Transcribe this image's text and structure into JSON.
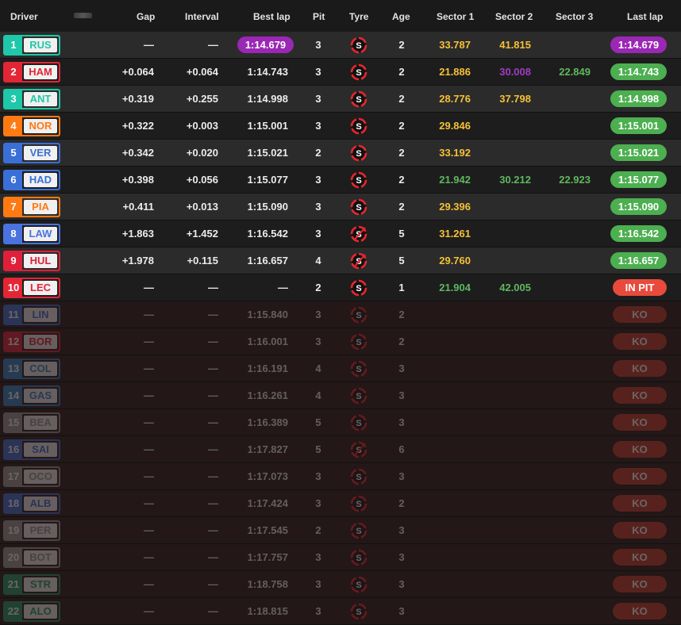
{
  "colors": {
    "purple": "#9b27b5",
    "green": "#4caf50",
    "yellow": "#f5c137",
    "sector_purple": "#a03cc4",
    "sector_green": "#5fb85f",
    "ko_red": "#c0392b",
    "in_pit_red": "#e84a3c",
    "soft_tyre": "#e8262e"
  },
  "headers": {
    "driver": "Driver",
    "gap": "Gap",
    "interval": "Interval",
    "best_lap": "Best lap",
    "pit": "Pit",
    "tyre": "Tyre",
    "age": "Age",
    "sector1": "Sector 1",
    "sector2": "Sector 2",
    "sector3": "Sector 3",
    "last_lap": "Last lap"
  },
  "rows": [
    {
      "pos": "1",
      "code": "RUS",
      "team_color": "#1ec8a8",
      "gap": "—",
      "interval": "—",
      "best": "1:14.679",
      "best_style": "purple",
      "pit": "3",
      "tyre": "soft-tyre-icon",
      "age": "2",
      "s1": "33.787",
      "s1c": "yellow",
      "s2": "41.815",
      "s2c": "yellow",
      "s3": "",
      "s3c": "",
      "last": "1:14.679",
      "last_style": "purple",
      "ko": false
    },
    {
      "pos": "2",
      "code": "HAM",
      "team_color": "#e32636",
      "gap": "+0.064",
      "interval": "+0.064",
      "best": "1:14.743",
      "best_style": "",
      "pit": "3",
      "tyre": "soft-tyre-icon",
      "age": "2",
      "s1": "21.886",
      "s1c": "yellow",
      "s2": "30.008",
      "s2c": "purple",
      "s3": "22.849",
      "s3c": "green",
      "last": "1:14.743",
      "last_style": "green",
      "ko": false
    },
    {
      "pos": "3",
      "code": "ANT",
      "team_color": "#1ec8a8",
      "gap": "+0.319",
      "interval": "+0.255",
      "best": "1:14.998",
      "best_style": "",
      "pit": "3",
      "tyre": "soft-tyre-icon",
      "age": "2",
      "s1": "28.776",
      "s1c": "yellow",
      "s2": "37.798",
      "s2c": "yellow",
      "s3": "",
      "s3c": "",
      "last": "1:14.998",
      "last_style": "green",
      "ko": false
    },
    {
      "pos": "4",
      "code": "NOR",
      "team_color": "#ff7a12",
      "gap": "+0.322",
      "interval": "+0.003",
      "best": "1:15.001",
      "best_style": "",
      "pit": "3",
      "tyre": "soft-tyre-icon",
      "age": "2",
      "s1": "29.846",
      "s1c": "yellow",
      "s2": "",
      "s2c": "",
      "s3": "",
      "s3c": "",
      "last": "1:15.001",
      "last_style": "green",
      "ko": false
    },
    {
      "pos": "5",
      "code": "VER",
      "team_color": "#3a6fd8",
      "gap": "+0.342",
      "interval": "+0.020",
      "best": "1:15.021",
      "best_style": "",
      "pit": "2",
      "tyre": "soft-tyre-icon",
      "age": "2",
      "s1": "33.192",
      "s1c": "yellow",
      "s2": "",
      "s2c": "",
      "s3": "",
      "s3c": "",
      "last": "1:15.021",
      "last_style": "green",
      "ko": false
    },
    {
      "pos": "6",
      "code": "HAD",
      "team_color": "#3a6fd8",
      "gap": "+0.398",
      "interval": "+0.056",
      "best": "1:15.077",
      "best_style": "",
      "pit": "3",
      "tyre": "soft-tyre-icon",
      "age": "2",
      "s1": "21.942",
      "s1c": "green",
      "s2": "30.212",
      "s2c": "green",
      "s3": "22.923",
      "s3c": "green",
      "last": "1:15.077",
      "last_style": "green",
      "ko": false
    },
    {
      "pos": "7",
      "code": "PIA",
      "team_color": "#ff7a12",
      "gap": "+0.411",
      "interval": "+0.013",
      "best": "1:15.090",
      "best_style": "",
      "pit": "3",
      "tyre": "soft-tyre-icon",
      "age": "2",
      "s1": "29.396",
      "s1c": "yellow",
      "s2": "",
      "s2c": "",
      "s3": "",
      "s3c": "",
      "last": "1:15.090",
      "last_style": "green",
      "ko": false
    },
    {
      "pos": "8",
      "code": "LAW",
      "team_color": "#4a72e0",
      "gap": "+1.863",
      "interval": "+1.452",
      "best": "1:16.542",
      "best_style": "",
      "pit": "3",
      "tyre": "soft-tyre-used-icon",
      "age": "5",
      "s1": "31.261",
      "s1c": "yellow",
      "s2": "",
      "s2c": "",
      "s3": "",
      "s3c": "",
      "last": "1:16.542",
      "last_style": "green",
      "ko": false
    },
    {
      "pos": "9",
      "code": "HUL",
      "team_color": "#e0203a",
      "gap": "+1.978",
      "interval": "+0.115",
      "best": "1:16.657",
      "best_style": "",
      "pit": "4",
      "tyre": "soft-tyre-used-icon",
      "age": "5",
      "s1": "29.760",
      "s1c": "yellow",
      "s2": "",
      "s2c": "",
      "s3": "",
      "s3c": "",
      "last": "1:16.657",
      "last_style": "green",
      "ko": false
    },
    {
      "pos": "10",
      "code": "LEC",
      "team_color": "#e32636",
      "gap": "—",
      "interval": "—",
      "best": "—",
      "best_style": "",
      "pit": "2",
      "tyre": "soft-tyre-icon",
      "age": "1",
      "s1": "21.904",
      "s1c": "green",
      "s2": "42.005",
      "s2c": "green",
      "s3": "",
      "s3c": "",
      "last": "IN PIT",
      "last_style": "inpit",
      "ko": false
    },
    {
      "pos": "11",
      "code": "LIN",
      "team_color": "#3a6fd8",
      "gap": "—",
      "interval": "—",
      "best": "1:15.840",
      "best_style": "",
      "pit": "3",
      "tyre": "soft-tyre-icon",
      "age": "2",
      "s1": "",
      "s1c": "",
      "s2": "",
      "s2c": "",
      "s3": "",
      "s3c": "",
      "last": "KO",
      "last_style": "ko",
      "ko": true
    },
    {
      "pos": "12",
      "code": "BOR",
      "team_color": "#e0203a",
      "gap": "—",
      "interval": "—",
      "best": "1:16.001",
      "best_style": "",
      "pit": "3",
      "tyre": "soft-tyre-icon",
      "age": "2",
      "s1": "",
      "s1c": "",
      "s2": "",
      "s2c": "",
      "s3": "",
      "s3c": "",
      "last": "KO",
      "last_style": "ko",
      "ko": true
    },
    {
      "pos": "13",
      "code": "COL",
      "team_color": "#2f86c8",
      "gap": "—",
      "interval": "—",
      "best": "1:16.191",
      "best_style": "",
      "pit": "4",
      "tyre": "soft-tyre-icon",
      "age": "3",
      "s1": "",
      "s1c": "",
      "s2": "",
      "s2c": "",
      "s3": "",
      "s3c": "",
      "last": "KO",
      "last_style": "ko",
      "ko": true
    },
    {
      "pos": "14",
      "code": "GAS",
      "team_color": "#2f86c8",
      "gap": "—",
      "interval": "—",
      "best": "1:16.261",
      "best_style": "",
      "pit": "4",
      "tyre": "soft-tyre-icon",
      "age": "3",
      "s1": "",
      "s1c": "",
      "s2": "",
      "s2c": "",
      "s3": "",
      "s3c": "",
      "last": "KO",
      "last_style": "ko",
      "ko": true
    },
    {
      "pos": "15",
      "code": "BEA",
      "team_color": "#9a9a9a",
      "gap": "—",
      "interval": "—",
      "best": "1:16.389",
      "best_style": "",
      "pit": "5",
      "tyre": "soft-tyre-icon",
      "age": "3",
      "s1": "",
      "s1c": "",
      "s2": "",
      "s2c": "",
      "s3": "",
      "s3c": "",
      "last": "KO",
      "last_style": "ko",
      "ko": true
    },
    {
      "pos": "16",
      "code": "SAI",
      "team_color": "#3a6fd8",
      "gap": "—",
      "interval": "—",
      "best": "1:17.827",
      "best_style": "",
      "pit": "5",
      "tyre": "soft-tyre-used-icon",
      "age": "6",
      "s1": "",
      "s1c": "",
      "s2": "",
      "s2c": "",
      "s3": "",
      "s3c": "",
      "last": "KO",
      "last_style": "ko",
      "ko": true
    },
    {
      "pos": "17",
      "code": "OCO",
      "team_color": "#9a9a9a",
      "gap": "—",
      "interval": "—",
      "best": "1:17.073",
      "best_style": "",
      "pit": "3",
      "tyre": "soft-tyre-icon",
      "age": "3",
      "s1": "",
      "s1c": "",
      "s2": "",
      "s2c": "",
      "s3": "",
      "s3c": "",
      "last": "KO",
      "last_style": "ko",
      "ko": true
    },
    {
      "pos": "18",
      "code": "ALB",
      "team_color": "#3a6fd8",
      "gap": "—",
      "interval": "—",
      "best": "1:17.424",
      "best_style": "",
      "pit": "3",
      "tyre": "soft-tyre-icon",
      "age": "2",
      "s1": "",
      "s1c": "",
      "s2": "",
      "s2c": "",
      "s3": "",
      "s3c": "",
      "last": "KO",
      "last_style": "ko",
      "ko": true
    },
    {
      "pos": "19",
      "code": "PER",
      "team_color": "#9a9a9a",
      "gap": "—",
      "interval": "—",
      "best": "1:17.545",
      "best_style": "",
      "pit": "2",
      "tyre": "soft-tyre-icon",
      "age": "3",
      "s1": "",
      "s1c": "",
      "s2": "",
      "s2c": "",
      "s3": "",
      "s3c": "",
      "last": "KO",
      "last_style": "ko",
      "ko": true
    },
    {
      "pos": "20",
      "code": "BOT",
      "team_color": "#9a9a9a",
      "gap": "—",
      "interval": "—",
      "best": "1:17.757",
      "best_style": "",
      "pit": "3",
      "tyre": "soft-tyre-icon",
      "age": "3",
      "s1": "",
      "s1c": "",
      "s2": "",
      "s2c": "",
      "s3": "",
      "s3c": "",
      "last": "KO",
      "last_style": "ko",
      "ko": true
    },
    {
      "pos": "21",
      "code": "STR",
      "team_color": "#1e9a6a",
      "gap": "—",
      "interval": "—",
      "best": "1:18.758",
      "best_style": "",
      "pit": "3",
      "tyre": "soft-tyre-icon",
      "age": "3",
      "s1": "",
      "s1c": "",
      "s2": "",
      "s2c": "",
      "s3": "",
      "s3c": "",
      "last": "KO",
      "last_style": "ko",
      "ko": true
    },
    {
      "pos": "22",
      "code": "ALO",
      "team_color": "#1e9a6a",
      "gap": "—",
      "interval": "—",
      "best": "1:18.815",
      "best_style": "",
      "pit": "3",
      "tyre": "soft-tyre-icon",
      "age": "3",
      "s1": "",
      "s1c": "",
      "s2": "",
      "s2c": "",
      "s3": "",
      "s3c": "",
      "last": "KO",
      "last_style": "ko",
      "ko": true
    }
  ]
}
